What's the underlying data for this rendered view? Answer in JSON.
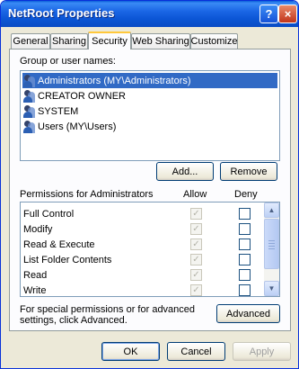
{
  "window": {
    "title": "NetRoot Properties"
  },
  "titlebar": {
    "help_glyph": "?",
    "close_glyph": "×"
  },
  "tabs": [
    {
      "label": "General",
      "active": false
    },
    {
      "label": "Sharing",
      "active": false
    },
    {
      "label": "Security",
      "active": true
    },
    {
      "label": "Web Sharing",
      "active": false
    },
    {
      "label": "Customize",
      "active": false
    }
  ],
  "groups": {
    "label": "Group or user names:",
    "items": [
      {
        "name": "Administrators (MY\\Administrators)",
        "selected": true
      },
      {
        "name": "CREATOR OWNER",
        "selected": false
      },
      {
        "name": "SYSTEM",
        "selected": false
      },
      {
        "name": "Users (MY\\Users)",
        "selected": false
      }
    ],
    "add_label": "Add...",
    "remove_label": "Remove"
  },
  "permissions": {
    "header": "Permissions for Administrators",
    "allow_header": "Allow",
    "deny_header": "Deny",
    "rows": [
      {
        "name": "Full Control",
        "allow": true,
        "deny": false
      },
      {
        "name": "Modify",
        "allow": true,
        "deny": false
      },
      {
        "name": "Read & Execute",
        "allow": true,
        "deny": false
      },
      {
        "name": "List Folder Contents",
        "allow": true,
        "deny": false
      },
      {
        "name": "Read",
        "allow": true,
        "deny": false
      },
      {
        "name": "Write",
        "allow": true,
        "deny": false
      }
    ]
  },
  "advanced": {
    "note": "For special permissions or for advanced settings, click Advanced.",
    "button_label": "Advanced"
  },
  "footer": {
    "ok_label": "OK",
    "cancel_label": "Cancel",
    "apply_label": "Apply"
  },
  "colors": {
    "title_bar": "#0a5fd8",
    "selection": "#316ac5",
    "close_button": "#c1341a",
    "active_tab_accent": "#ffc83c"
  }
}
